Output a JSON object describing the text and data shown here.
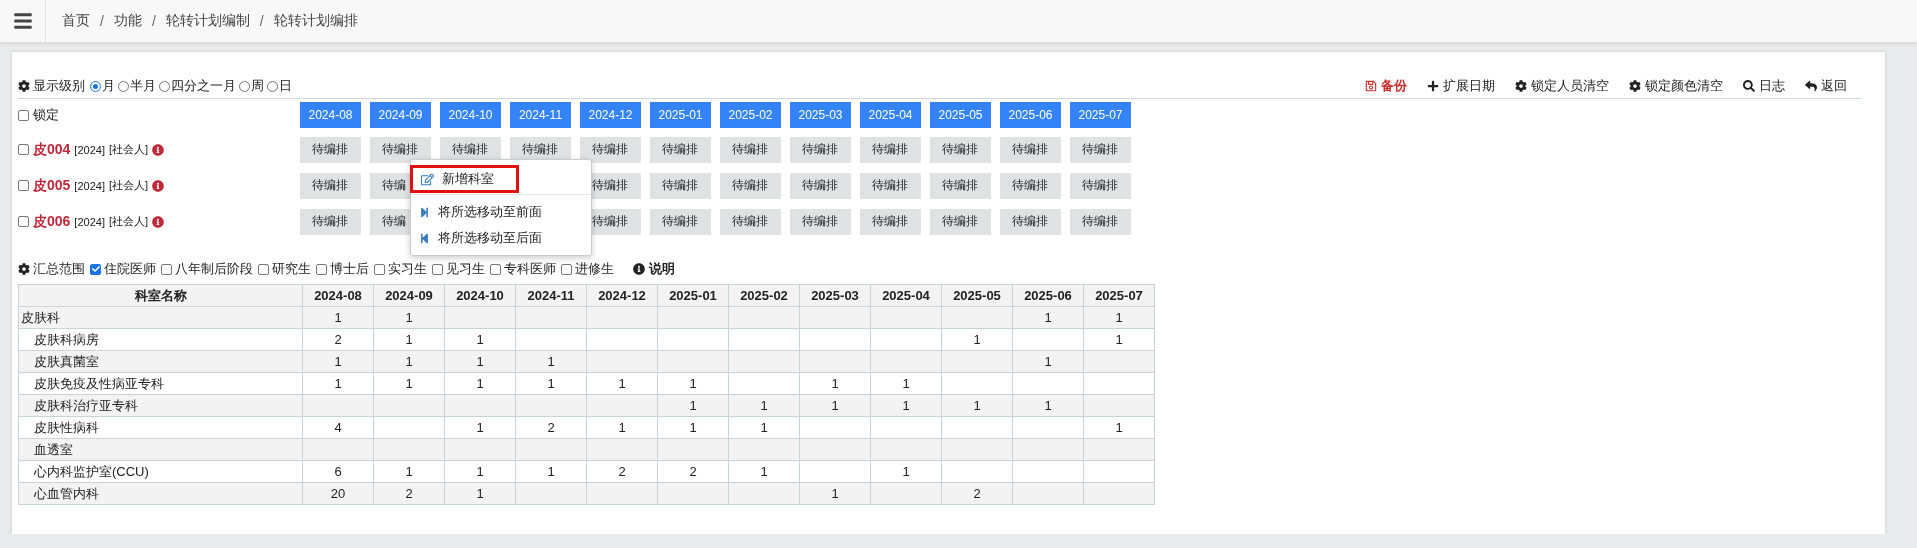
{
  "breadcrumb": {
    "items": [
      "首页",
      "功能",
      "轮转计划编制",
      "轮转计划编排"
    ],
    "separators": [
      "/",
      "/",
      "/"
    ]
  },
  "display_level": {
    "label": "显示级别",
    "options": [
      {
        "label": "月",
        "selected": true
      },
      {
        "label": "半月",
        "selected": false
      },
      {
        "label": "四分之一月",
        "selected": false
      },
      {
        "label": "周",
        "selected": false
      },
      {
        "label": "日",
        "selected": false
      }
    ]
  },
  "actions": [
    {
      "label": "备份",
      "kind": "save"
    },
    {
      "label": "扩展日期",
      "kind": "plus"
    },
    {
      "label": "锁定人员清空",
      "kind": "gear"
    },
    {
      "label": "锁定颜色清空",
      "kind": "gear"
    },
    {
      "label": "日志",
      "kind": "search"
    },
    {
      "label": "返回",
      "kind": "back"
    }
  ],
  "lock": {
    "label": "锁定",
    "checked": false
  },
  "months": [
    "2024-08",
    "2024-09",
    "2024-10",
    "2024-11",
    "2024-12",
    "2025-01",
    "2025-02",
    "2025-03",
    "2025-04",
    "2025-05",
    "2025-06",
    "2025-07"
  ],
  "people": [
    {
      "name": "皮004",
      "year": "[2024]",
      "type": "[社会人]",
      "checked": false,
      "cells": [
        {
          "text": "待编排"
        },
        {
          "text": "待编排"
        },
        {
          "text": "待编排"
        },
        {
          "text": "待编排"
        },
        {
          "text": "待编排"
        },
        {
          "text": "待编排"
        },
        {
          "text": "待编排"
        },
        {
          "text": "待编排"
        },
        {
          "text": "待编排"
        },
        {
          "text": "待编排"
        },
        {
          "text": "待编排"
        },
        {
          "text": "待编排"
        }
      ]
    },
    {
      "name": "皮005",
      "year": "[2024]",
      "type": "[社会人]",
      "checked": false,
      "cells": [
        {
          "text": "待编排"
        },
        {
          "text": "待编"
        },
        {
          "kind": "covered"
        },
        {
          "kind": "covered"
        },
        {
          "text": "待编排"
        },
        {
          "text": "待编排"
        },
        {
          "text": "待编排"
        },
        {
          "text": "待编排"
        },
        {
          "text": "待编排"
        },
        {
          "text": "待编排"
        },
        {
          "text": "待编排"
        },
        {
          "text": "待编排"
        }
      ]
    },
    {
      "name": "皮006",
      "year": "[2024]",
      "type": "[社会人]",
      "checked": false,
      "cells": [
        {
          "text": "待编排"
        },
        {
          "text": "待编"
        },
        {
          "kind": "covered"
        },
        {
          "kind": "covered"
        },
        {
          "text": "待编排"
        },
        {
          "text": "待编排"
        },
        {
          "text": "待编排"
        },
        {
          "text": "待编排"
        },
        {
          "text": "待编排"
        },
        {
          "text": "待编排"
        },
        {
          "text": "待编排"
        },
        {
          "text": "待编排"
        }
      ]
    }
  ],
  "context_menu": [
    {
      "label": "新增科室",
      "kind": "edit",
      "highlighted": true
    },
    {
      "label": "将所选移动至前面",
      "kind": "forward",
      "highlighted": false
    },
    {
      "label": "将所选移动至后面",
      "kind": "backward",
      "highlighted": false
    }
  ],
  "summary": {
    "label": "汇总范围",
    "filters": [
      {
        "label": "住院医师",
        "checked": true
      },
      {
        "label": "八年制后阶段",
        "checked": false
      },
      {
        "label": "研究生",
        "checked": false
      },
      {
        "label": "博士后",
        "checked": false
      },
      {
        "label": "实习生",
        "checked": false
      },
      {
        "label": "见习生",
        "checked": false
      },
      {
        "label": "专科医师",
        "checked": false
      },
      {
        "label": "进修生",
        "checked": false
      }
    ],
    "help": "说明"
  },
  "table": {
    "columns": [
      "科室名称",
      "2024-08",
      "2024-09",
      "2024-10",
      "2024-11",
      "2024-12",
      "2025-01",
      "2025-02",
      "2025-03",
      "2025-04",
      "2025-05",
      "2025-06",
      "2025-07"
    ],
    "rows": [
      {
        "name": "皮肤科",
        "values": [
          {
            "text": "1"
          },
          {
            "text": "1"
          },
          {
            "kind": "empty"
          },
          {
            "kind": "empty"
          },
          {
            "kind": "empty"
          },
          {
            "kind": "empty"
          },
          {
            "kind": "empty"
          },
          {
            "kind": "empty"
          },
          {
            "kind": "empty"
          },
          {
            "kind": "empty"
          },
          {
            "text": "1"
          },
          {
            "text": "1"
          }
        ],
        "children": [
          {
            "name": "皮肤科病房",
            "values": [
              {
                "text": "2"
              },
              {
                "text": "1"
              },
              {
                "text": "1"
              },
              {
                "kind": "empty"
              },
              {
                "kind": "empty"
              },
              {
                "kind": "empty"
              },
              {
                "kind": "empty"
              },
              {
                "kind": "empty"
              },
              {
                "kind": "empty"
              },
              {
                "text": "1"
              },
              {
                "kind": "empty"
              },
              {
                "text": "1"
              }
            ]
          },
          {
            "name": "皮肤真菌室",
            "values": [
              {
                "text": "1"
              },
              {
                "text": "1"
              },
              {
                "text": "1"
              },
              {
                "text": "1"
              },
              {
                "kind": "empty"
              },
              {
                "kind": "empty"
              },
              {
                "kind": "empty"
              },
              {
                "kind": "empty"
              },
              {
                "kind": "empty"
              },
              {
                "kind": "empty"
              },
              {
                "text": "1"
              },
              {
                "kind": "empty"
              }
            ]
          },
          {
            "name": "皮肤免疫及性病亚专科",
            "values": [
              {
                "text": "1"
              },
              {
                "text": "1"
              },
              {
                "text": "1"
              },
              {
                "text": "1"
              },
              {
                "text": "1"
              },
              {
                "text": "1"
              },
              {
                "kind": "empty"
              },
              {
                "text": "1"
              },
              {
                "text": "1"
              },
              {
                "kind": "empty"
              },
              {
                "kind": "empty"
              },
              {
                "kind": "empty"
              }
            ]
          },
          {
            "name": "皮肤科治疗亚专科",
            "values": [
              {
                "kind": "empty"
              },
              {
                "kind": "empty"
              },
              {
                "kind": "empty"
              },
              {
                "kind": "empty"
              },
              {
                "kind": "empty"
              },
              {
                "text": "1"
              },
              {
                "text": "1"
              },
              {
                "text": "1"
              },
              {
                "text": "1"
              },
              {
                "text": "1"
              },
              {
                "text": "1"
              },
              {
                "kind": "empty"
              }
            ]
          },
          {
            "name": "皮肤性病科",
            "values": [
              {
                "text": "4"
              },
              {
                "kind": "empty"
              },
              {
                "text": "1"
              },
              {
                "text": "2"
              },
              {
                "text": "1"
              },
              {
                "text": "1"
              },
              {
                "text": "1"
              },
              {
                "kind": "empty"
              },
              {
                "kind": "empty"
              },
              {
                "kind": "empty"
              },
              {
                "kind": "empty"
              },
              {
                "text": "1"
              }
            ]
          },
          {
            "name": "血透室",
            "values": [
              {
                "kind": "empty"
              },
              {
                "kind": "empty"
              },
              {
                "kind": "empty"
              },
              {
                "kind": "empty"
              },
              {
                "kind": "empty"
              },
              {
                "kind": "empty"
              },
              {
                "kind": "empty"
              },
              {
                "kind": "empty"
              },
              {
                "kind": "empty"
              },
              {
                "kind": "empty"
              },
              {
                "kind": "empty"
              },
              {
                "kind": "empty"
              }
            ]
          },
          {
            "name": "心内科监护室(CCU)",
            "values": [
              {
                "text": "6"
              },
              {
                "text": "1"
              },
              {
                "text": "1"
              },
              {
                "text": "1"
              },
              {
                "text": "2"
              },
              {
                "text": "2"
              },
              {
                "text": "1"
              },
              {
                "kind": "empty"
              },
              {
                "text": "1"
              },
              {
                "kind": "empty"
              },
              {
                "kind": "empty"
              },
              {
                "kind": "empty"
              }
            ]
          },
          {
            "name": "心血管内科",
            "values": [
              {
                "text": "20"
              },
              {
                "text": "2"
              },
              {
                "text": "1"
              },
              {
                "kind": "empty"
              },
              {
                "kind": "empty"
              },
              {
                "kind": "empty"
              },
              {
                "kind": "empty"
              },
              {
                "text": "1"
              },
              {
                "kind": "empty"
              },
              {
                "text": "2"
              },
              {
                "kind": "empty"
              },
              {
                "kind": "empty"
              }
            ]
          }
        ]
      }
    ]
  }
}
